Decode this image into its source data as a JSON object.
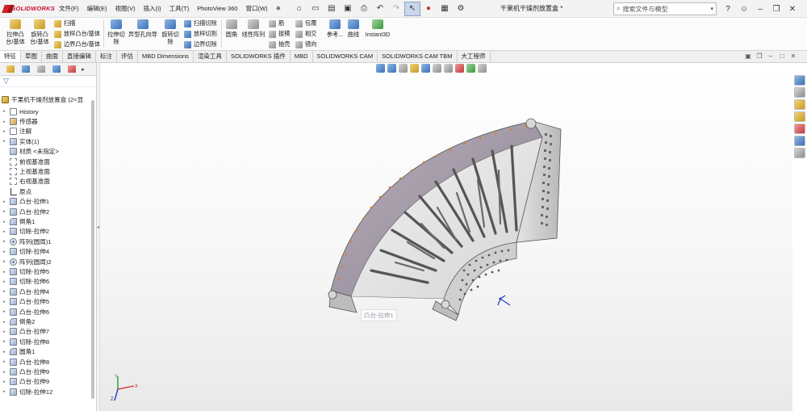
{
  "app": {
    "logo_text": "SOLIDWORKS",
    "brand_color": "#d71f26"
  },
  "menu": {
    "items": [
      "文件(F)",
      "编辑(E)",
      "视图(V)",
      "插入(I)",
      "工具(T)",
      "PhotoView 360",
      "窗口(W)"
    ]
  },
  "document": {
    "title": "干果机干燥剂放置盒 *"
  },
  "search": {
    "placeholder": "搜索文件与模型"
  },
  "ribbon": {
    "extrude_boss": "拉伸凸台/基体",
    "revolve_boss": "旋转凸台/基体",
    "sweep": "扫描",
    "loft_boss": "放样凸台/基体",
    "boundary_boss": "边界凸台/基体",
    "extrude_cut": "拉伸切除",
    "hole_wizard": "异型孔向导",
    "revolve_cut": "旋转切除",
    "swept_cut": "扫描切除",
    "lofted_cut": "放样切割",
    "boundary_cut": "边界切除",
    "fillet": "圆角",
    "linear_pattern": "线性阵列",
    "rib": "筋",
    "draft": "拔模",
    "shell": "抽壳",
    "wrap": "包覆",
    "intersect": "相交",
    "mirror": "镜向",
    "reference": "参考...",
    "curves": "曲线",
    "instant3d": "Instant3D"
  },
  "tabs": {
    "items": [
      "特征",
      "草图",
      "曲面",
      "直接编辑",
      "标注",
      "评估",
      "MBD Dimensions",
      "渲染工具",
      "SOLIDWORKS 插件",
      "MBD",
      "SOLIDWORKS CAM",
      "SOLIDWORKS CAM TBM",
      "大工程师"
    ],
    "active": "特征"
  },
  "tree": {
    "root": "干果机干燥剂放置盒 (2<显",
    "items": [
      {
        "label": "History",
        "icon": "history"
      },
      {
        "label": "传感器",
        "icon": "sensor"
      },
      {
        "label": "注解",
        "icon": "note"
      },
      {
        "label": "实体(1)",
        "icon": "body"
      },
      {
        "label": "材质 <未指定>",
        "icon": "material"
      },
      {
        "label": "前视基准面",
        "icon": "plane"
      },
      {
        "label": "上视基准面",
        "icon": "plane"
      },
      {
        "label": "右视基准面",
        "icon": "plane"
      },
      {
        "label": "原点",
        "icon": "origin"
      },
      {
        "label": "凸台-拉伸1",
        "icon": "feature"
      },
      {
        "label": "凸台-拉伸2",
        "icon": "feature"
      },
      {
        "label": "倒角1",
        "icon": "fillet"
      },
      {
        "label": "切除-拉伸2",
        "icon": "feature"
      },
      {
        "label": "阵列(圆周)1",
        "icon": "pattern"
      },
      {
        "label": "切除-拉伸4",
        "icon": "feature"
      },
      {
        "label": "阵列(圆周)2",
        "icon": "pattern"
      },
      {
        "label": "切除-拉伸5",
        "icon": "feature"
      },
      {
        "label": "切除-拉伸6",
        "icon": "feature"
      },
      {
        "label": "凸台-拉伸4",
        "icon": "feature"
      },
      {
        "label": "凸台-拉伸5",
        "icon": "feature"
      },
      {
        "label": "凸台-拉伸6",
        "icon": "feature"
      },
      {
        "label": "倒角2",
        "icon": "fillet"
      },
      {
        "label": "凸台-拉伸7",
        "icon": "feature"
      },
      {
        "label": "切除-拉伸8",
        "icon": "feature"
      },
      {
        "label": "圆角1",
        "icon": "fillet"
      },
      {
        "label": "凸台-拉伸8",
        "icon": "feature"
      },
      {
        "label": "凸台-拉伸9",
        "icon": "feature"
      },
      {
        "label": "凸台-拉伸9",
        "icon": "feature"
      },
      {
        "label": "切除-拉伸12",
        "icon": "feature"
      }
    ]
  },
  "viewport": {
    "tooltip": "凸台-拉伸1"
  }
}
